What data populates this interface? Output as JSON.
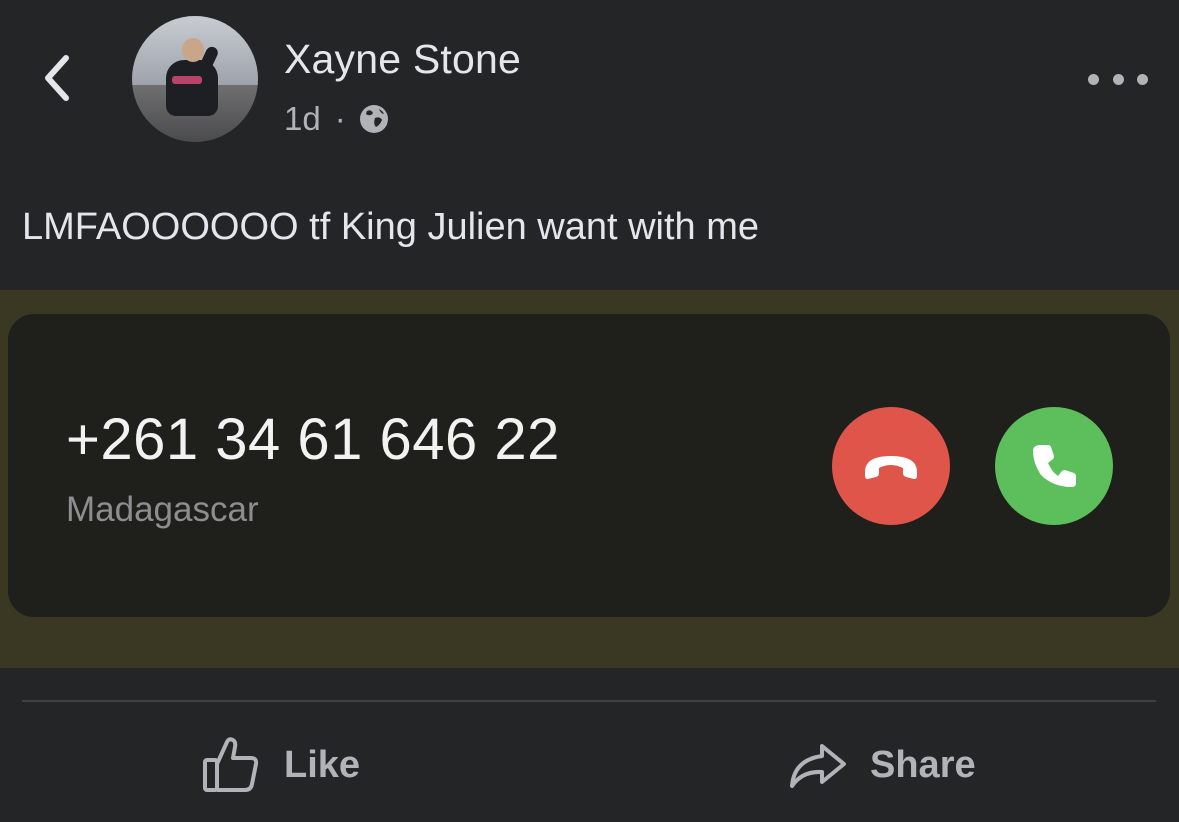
{
  "header": {
    "author_name": "Xayne Stone",
    "timestamp": "1d",
    "separator": "·",
    "privacy_icon": "globe-icon",
    "back_icon": "chevron-left-icon",
    "more_icon": "more-horizontal-icon"
  },
  "post": {
    "text": "LMFAOOOOOO tf King Julien want with me"
  },
  "call_screenshot": {
    "phone_number": "+261 34 61 646 22",
    "country": "Madagascar",
    "decline_icon": "phone-hangup-icon",
    "accept_icon": "phone-icon",
    "colors": {
      "decline": "#e0554a",
      "accept": "#5cbf5b"
    }
  },
  "actions": {
    "like_label": "Like",
    "like_icon": "thumbs-up-icon",
    "share_label": "Share",
    "share_icon": "share-arrow-icon"
  }
}
